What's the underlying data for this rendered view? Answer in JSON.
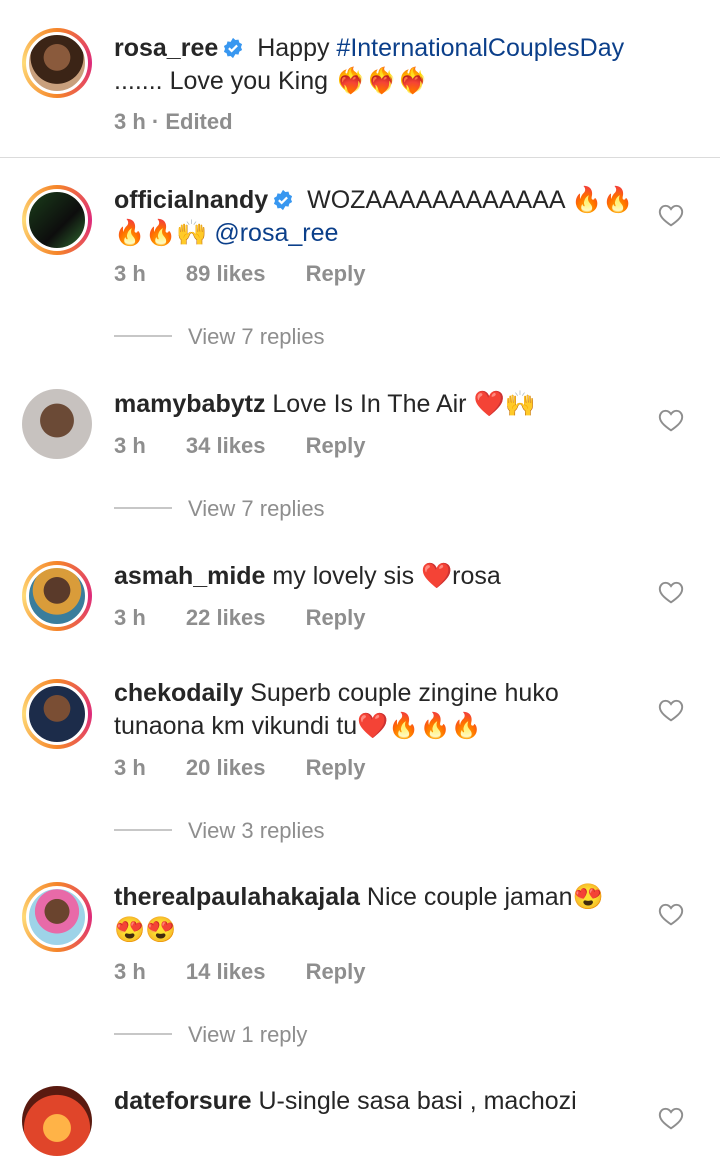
{
  "caption": {
    "username": "rosa_ree",
    "text_pre": "Happy ",
    "hashtag": "#InternationalCouplesDay",
    "text_post": "....... Love you King ❤️‍🔥❤️‍🔥❤️‍🔥",
    "time": "3 h · Edited"
  },
  "comments": [
    {
      "username": "officialnandy",
      "verified": true,
      "text": "WOZAAAAAAAAAAAA 🔥🔥🔥🔥🙌",
      "mention": "@rosa_ree",
      "time": "3 h",
      "likes": "89 likes",
      "reply": "Reply",
      "view_replies": "View 7 replies"
    },
    {
      "username": "mamybabytz",
      "text": "Love Is In The Air ❤️🙌",
      "time": "3 h",
      "likes": "34 likes",
      "reply": "Reply",
      "view_replies": "View 7 replies"
    },
    {
      "username": "asmah_mide",
      "text": "my lovely sis ❤️rosa",
      "time": "3 h",
      "likes": "22 likes",
      "reply": "Reply"
    },
    {
      "username": "chekodaily",
      "text": "Superb couple zingine huko tunaona km vikundi tu❤️🔥🔥🔥",
      "time": "3 h",
      "likes": "20 likes",
      "reply": "Reply",
      "view_replies": "View 3 replies"
    },
    {
      "username": "therealpaulahakajala",
      "text": "Nice couple jaman😍😍😍",
      "time": "3 h",
      "likes": "14 likes",
      "reply": "Reply",
      "view_replies": "View 1 reply"
    },
    {
      "username": "dateforsure",
      "text": "U-single sasa basi , machozi"
    }
  ],
  "colors": {
    "verified": "#3897f0",
    "hashtag": "#0b3f8a",
    "meta": "#8e8e8e"
  },
  "icons": {
    "like": "heart-outline-icon",
    "verified": "verified-badge-icon"
  }
}
